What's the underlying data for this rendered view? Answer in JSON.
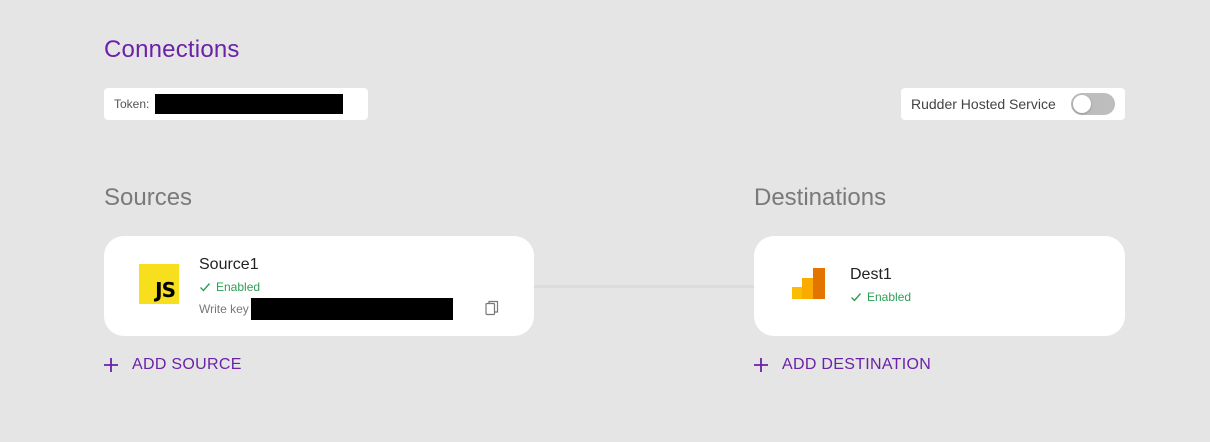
{
  "header": {
    "title": "Connections",
    "token_label": "Token:",
    "hosted_service_label": "Rudder Hosted Service",
    "hosted_service_enabled": false
  },
  "sources": {
    "title": "Sources",
    "items": [
      {
        "name": "Source1",
        "status": "Enabled",
        "write_key_label": "Write key",
        "icon": "javascript-icon",
        "icon_text": "JS"
      }
    ],
    "add_label": "ADD SOURCE"
  },
  "destinations": {
    "title": "Destinations",
    "items": [
      {
        "name": "Dest1",
        "status": "Enabled",
        "icon": "google-analytics-icon"
      }
    ],
    "add_label": "ADD DESTINATION"
  },
  "colors": {
    "accent": "#6b21a8",
    "enabled": "#2e9e55",
    "background": "#e5e5e5"
  }
}
